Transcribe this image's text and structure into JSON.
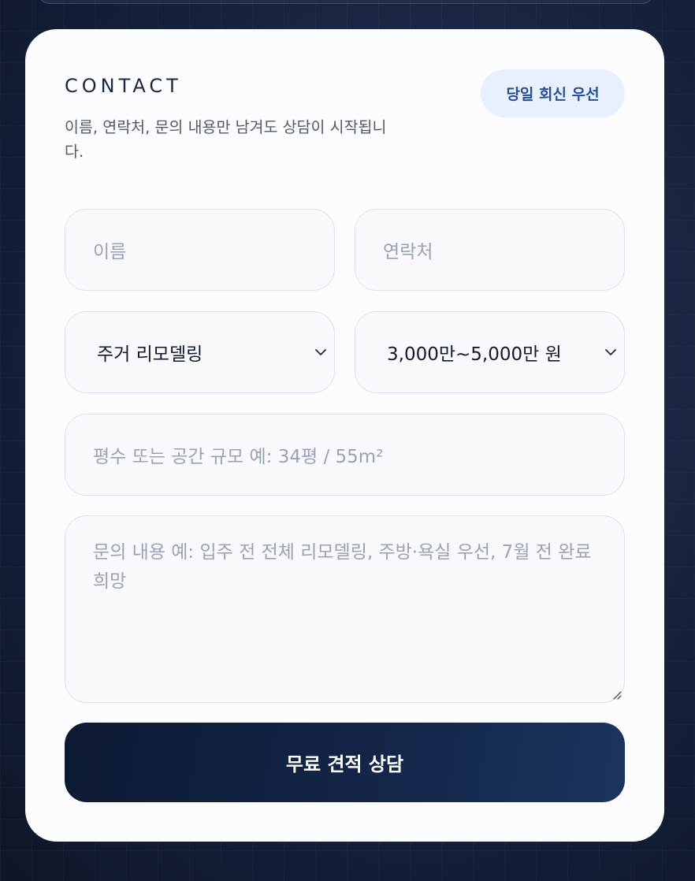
{
  "form": {
    "eyebrow": "CONTACT",
    "badge": "당일 회신 우선",
    "description": "이름, 연락처, 문의 내용만 남겨도 상담이 시작됩니다.",
    "name_placeholder": "이름",
    "phone_placeholder": "연락처",
    "project_type": "주거 리모델링",
    "budget": "3,000만~5,000만 원",
    "size_placeholder": "평수 또는 공간 규모 예: 34평 / 55m²",
    "message_placeholder": "문의 내용 예: 입주 전 전체 리모델링, 주방·욕실 우선, 7월 전 완료 희망",
    "submit_label": "무료 견적 상담"
  },
  "icons": {
    "select_chevron": "chevron-down-icon",
    "resize_grip": "resize-grip-icon"
  },
  "colors": {
    "card_bg": "#fbfcfe",
    "accent_navy": "#0e1a33",
    "badge_bg": "#e9f0fd",
    "badge_text": "#2a4f97"
  }
}
